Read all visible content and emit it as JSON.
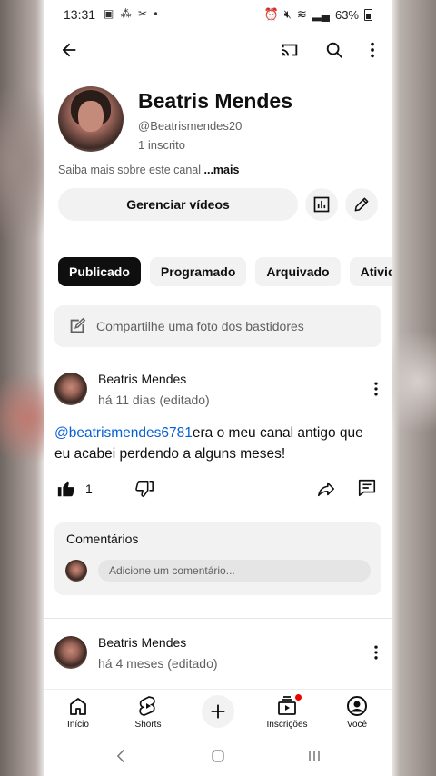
{
  "status_bar": {
    "time": "13:31",
    "battery": "63%"
  },
  "channel": {
    "name": "Beatris Mendes",
    "handle": "@Beatrismendes20",
    "subscribers": "1 inscrito",
    "about": "Saiba mais sobre este canal",
    "about_more": "...mais",
    "manage_label": "Gerenciar vídeos"
  },
  "tabs": [
    {
      "label": "Publicado",
      "active": true
    },
    {
      "label": "Programado",
      "active": false
    },
    {
      "label": "Arquivado",
      "active": false
    },
    {
      "label": "Atividad",
      "active": false
    }
  ],
  "share_box": {
    "placeholder": "Compartilhe uma foto dos bastidores"
  },
  "posts": [
    {
      "author": "Beatris Mendes",
      "time": "há 11 dias (editado)",
      "mention": "@beatrismendes6781",
      "text": "era o meu canal antigo que eu acabei perdendo a alguns meses!",
      "likes": "1"
    },
    {
      "author": "Beatris Mendes",
      "time": "há 4 meses (editado)"
    }
  ],
  "comments": {
    "title": "Comentários",
    "placeholder": "Adicione um comentário..."
  },
  "bottom_nav": {
    "home": "Início",
    "shorts": "Shorts",
    "subscriptions": "Inscrições",
    "you": "Você"
  },
  "colors": {
    "accent_link": "#065fd4",
    "notification": "#ee0000",
    "chip_active": "#0f0f0f"
  }
}
